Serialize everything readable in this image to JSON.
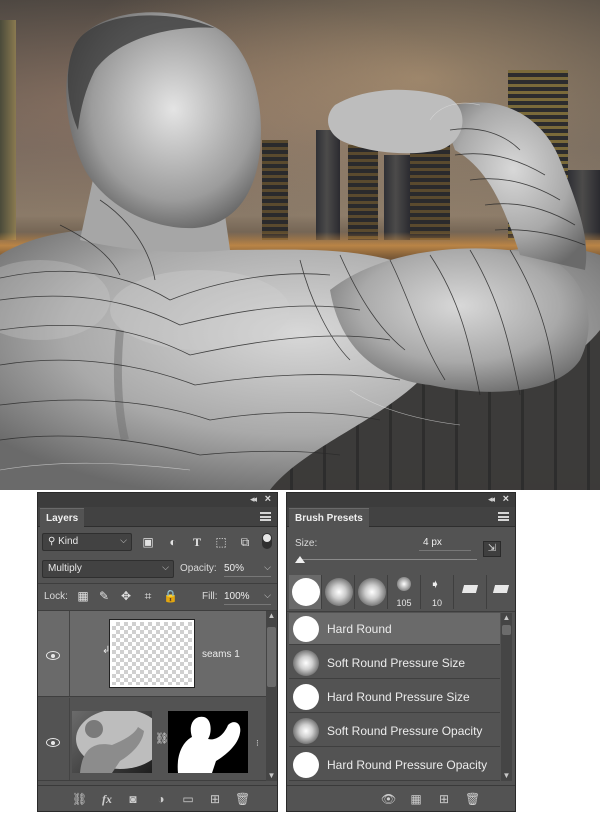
{
  "canvas": {
    "description_icon": "photo-canvas"
  },
  "layers_panel": {
    "tab_label": "Layers",
    "filter": {
      "value": "Kind"
    },
    "filter_icons": [
      "image-filter-icon",
      "adjustment-filter-icon",
      "type-filter-icon",
      "shape-filter-icon",
      "smart-object-filter-icon"
    ],
    "blend_mode": "Multiply",
    "opacity_label": "Opacity:",
    "opacity_value": "50%",
    "lock_label": "Lock:",
    "fill_label": "Fill:",
    "fill_value": "100%",
    "layers": [
      {
        "name": "seams 1",
        "visible": true,
        "selected": true,
        "clipped": true
      },
      {
        "name": "",
        "visible": true,
        "selected": false,
        "has_mask": true
      }
    ],
    "footer_icons": [
      "link-layers-icon",
      "fx-icon",
      "add-mask-icon",
      "adjustment-layer-icon",
      "new-group-icon",
      "new-layer-icon",
      "delete-layer-icon"
    ],
    "fx_label": "fx"
  },
  "brush_panel": {
    "tab_label": "Brush Presets",
    "size_label": "Size:",
    "size_value": "4 px",
    "tips": [
      {
        "type": "hard",
        "num": ""
      },
      {
        "type": "soft",
        "num": ""
      },
      {
        "type": "soft",
        "num": ""
      },
      {
        "type": "soft-small",
        "num": "105"
      },
      {
        "type": "arrow",
        "num": "10"
      },
      {
        "type": "flat",
        "num": ""
      },
      {
        "type": "flat",
        "num": ""
      }
    ],
    "presets": [
      {
        "label": "Hard Round",
        "style": "hard",
        "selected": true
      },
      {
        "label": "Soft Round Pressure Size",
        "style": "soft",
        "selected": false
      },
      {
        "label": "Hard Round Pressure Size",
        "style": "hard",
        "selected": false
      },
      {
        "label": "Soft Round Pressure Opacity",
        "style": "soft",
        "selected": false
      },
      {
        "label": "Hard Round Pressure Opacity",
        "style": "hard",
        "selected": false
      }
    ],
    "footer_icons": [
      "toggle-brush-panel-icon",
      "open-preset-manager-icon",
      "new-brush-icon",
      "delete-brush-icon"
    ]
  },
  "colors": {
    "panel_bg": "#535353",
    "panel_dark": "#424242",
    "selection": "#6a6a6a",
    "text": "#e6e6e6"
  }
}
